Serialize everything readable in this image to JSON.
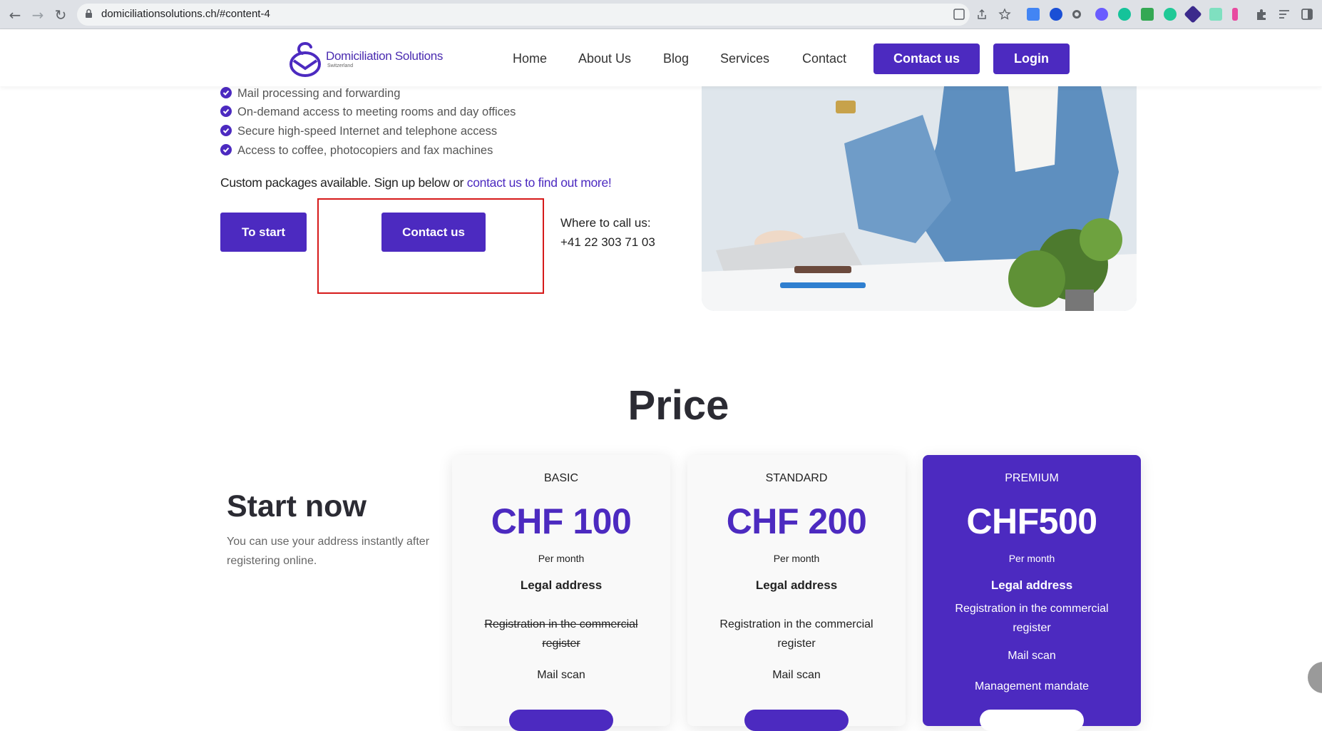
{
  "browser": {
    "url": "domiciliationsolutions.ch/#content-4",
    "back_icon": "arrow-left-icon",
    "forward_icon": "arrow-right-icon",
    "reload_icon": "reload-icon"
  },
  "header": {
    "logo_name": "Domiciliation Solutions",
    "logo_sub": "Switzerland",
    "nav": [
      "Home",
      "About Us",
      "Blog",
      "Services",
      "Contact"
    ],
    "contact_button": "Contact us",
    "login_button": "Login"
  },
  "features": [
    "Mail processing and forwarding",
    "On-demand access to meeting rooms and day offices",
    "Secure high-speed Internet and telephone access",
    "Access to coffee, photocopiers and fax machines"
  ],
  "custom": {
    "text": "Custom packages available. Sign up below or ",
    "link": "contact us to find out more!"
  },
  "cta": {
    "start": "To start",
    "contact": "Contact us",
    "call_label": "Where to call us:",
    "phone": "+41 22 303 71 03"
  },
  "price": {
    "title": "Price",
    "start_title": "Start now",
    "start_sub": "You can use your address instantly after registering online.",
    "plans": [
      {
        "tier": "BASIC",
        "amount": "CHF 100",
        "per": "Per month",
        "feature1": "Legal address",
        "feature2": "Registration in the commercial register",
        "feature3": "Mail scan"
      },
      {
        "tier": "STANDARD",
        "amount": "CHF 200",
        "per": "Per month",
        "feature1": "Legal address",
        "feature2": "Registration in the commercial register",
        "feature3": "Mail scan"
      },
      {
        "tier": "PREMIUM",
        "amount": "CHF500",
        "per": "Per month",
        "feature1": "Legal address",
        "feature2": "Registration in the commercial register",
        "feature3": "Mail scan",
        "feature4": "Management mandate"
      }
    ]
  },
  "colors": {
    "brand": "#4c2ac0",
    "highlight_box": "#d61a1a"
  }
}
